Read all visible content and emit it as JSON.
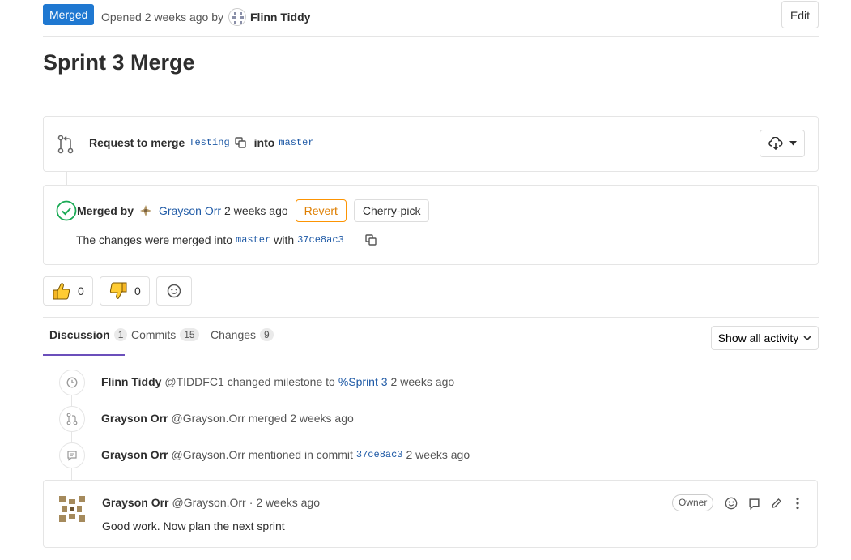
{
  "header": {
    "status": "Merged",
    "opened_text": "Opened 2 weeks ago by",
    "author": "Flinn Tiddy",
    "edit_label": "Edit"
  },
  "title": "Sprint 3 Merge",
  "merge_request": {
    "request_label": "Request to merge",
    "source_branch": "Testing",
    "into_label": "into",
    "target_branch": "master"
  },
  "merged": {
    "merged_by_label": "Merged by",
    "merger": "Grayson Orr",
    "time": "2 weeks ago",
    "revert_label": "Revert",
    "cherry_pick_label": "Cherry-pick",
    "changes_text": "The changes were merged into",
    "branch": "master",
    "with_label": "with",
    "commit": "37ce8ac3"
  },
  "awards": {
    "thumbsup_count": "0",
    "thumbsdown_count": "0"
  },
  "tabs": [
    {
      "label": "Discussion",
      "count": "1"
    },
    {
      "label": "Commits",
      "count": "15"
    },
    {
      "label": "Changes",
      "count": "9"
    }
  ],
  "activity_filter": "Show all activity",
  "timeline": [
    {
      "author": "Flinn Tiddy",
      "handle": "@TIDDFC1",
      "action": "changed milestone to",
      "link": "%Sprint 3",
      "time": "2 weeks ago"
    },
    {
      "author": "Grayson Orr",
      "handle": "@Grayson.Orr",
      "action": "merged",
      "time": "2 weeks ago"
    },
    {
      "author": "Grayson Orr",
      "handle": "@Grayson.Orr",
      "action": "mentioned in commit",
      "link": "37ce8ac3",
      "time": "2 weeks ago"
    }
  ],
  "comment": {
    "author": "Grayson Orr",
    "handle": "@Grayson.Orr",
    "separator": "·",
    "time": "2 weeks ago",
    "role": "Owner",
    "body": "Good work. Now plan the next sprint"
  },
  "colors": {
    "merged_blue": "#1f78d1",
    "link_blue": "#1f5aa6",
    "success_green": "#1aaa55",
    "revert_orange": "#fc9403",
    "tab_active": "#6b4fbb"
  }
}
